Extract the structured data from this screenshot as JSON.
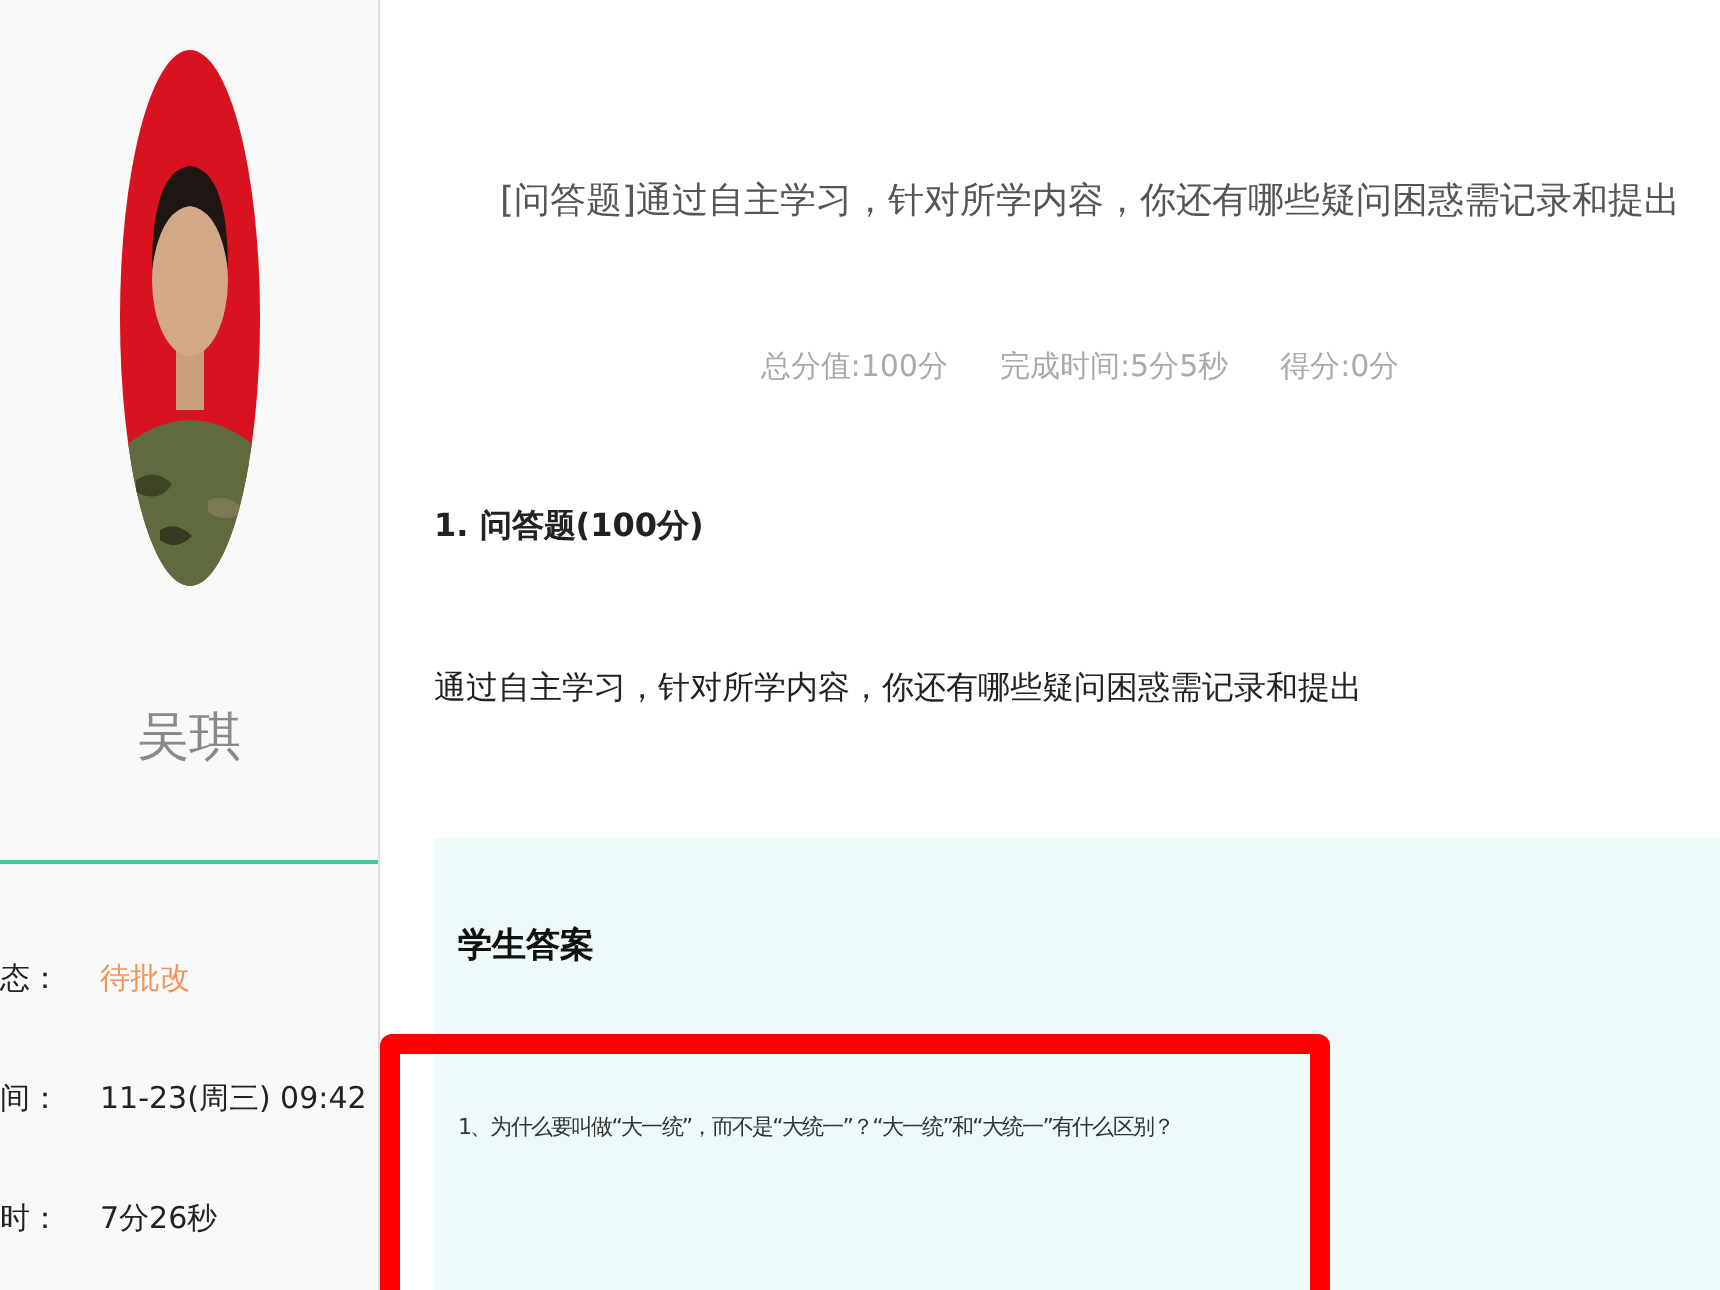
{
  "profile": {
    "name": "吴琪",
    "info": [
      {
        "label": "态：",
        "value": "待批改",
        "kind": "status"
      },
      {
        "label": "间：",
        "value": "11-23(周三) 09:42",
        "kind": "text"
      },
      {
        "label": "时：",
        "value": "7分26秒",
        "kind": "text"
      }
    ]
  },
  "question": {
    "title": "[问答题]通过自主学习，针对所学内容，你还有哪些疑问困惑需记录和提出",
    "meta": [
      "总分值:100分",
      "完成时间:5分5秒",
      "得分:0分"
    ],
    "heading": "1. 问答题(100分)",
    "prompt": "通过自主学习，针对所学内容，你还有哪些疑问困惑需记录和提出",
    "answer": {
      "heading": "学生答案",
      "text": "1、为什么要叫做“大一统”，而不是“大统一”？“大一统”和“大统一”有什么区别？",
      "highlighted": true
    }
  }
}
